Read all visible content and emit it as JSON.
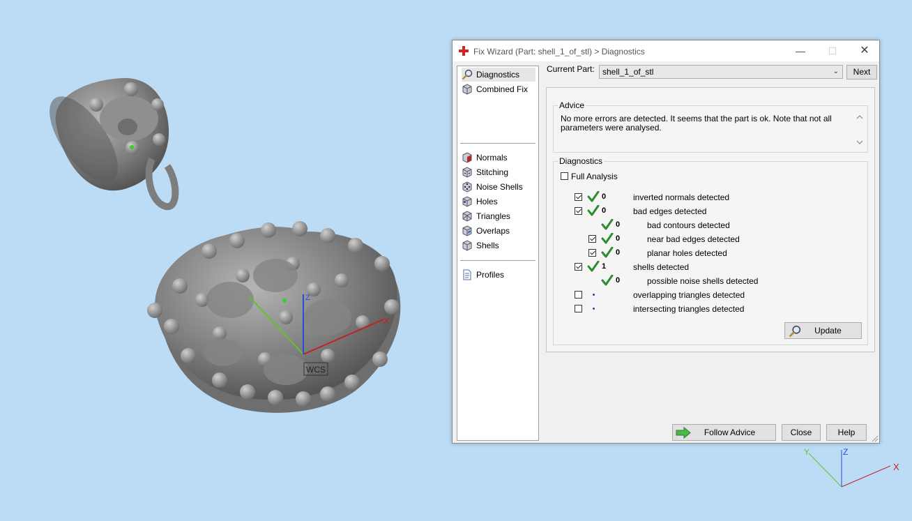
{
  "window": {
    "title": "Fix Wizard (Part: shell_1_of_stl) > Diagnostics",
    "minimize_glyph": "—",
    "maximize_glyph": "☐",
    "close_glyph": "✕"
  },
  "nav": {
    "items": [
      {
        "label": "Diagnostics",
        "icon": "magnifier-icon",
        "active": true
      },
      {
        "label": "Combined Fix",
        "icon": "cube-icon"
      },
      {
        "label": "Normals",
        "icon": "normals-cube-icon"
      },
      {
        "label": "Stitching",
        "icon": "stitching-cube-icon"
      },
      {
        "label": "Noise Shells",
        "icon": "dice-icon"
      },
      {
        "label": "Holes",
        "icon": "holes-cube-icon"
      },
      {
        "label": "Triangles",
        "icon": "triangles-cube-icon"
      },
      {
        "label": "Overlaps",
        "icon": "overlaps-cube-icon"
      },
      {
        "label": "Shells",
        "icon": "shells-cube-icon"
      },
      {
        "label": "Profiles",
        "icon": "document-icon"
      }
    ]
  },
  "header": {
    "current_part_label": "Current Part:",
    "current_part_value": "shell_1_of_stl",
    "next_label": "Next"
  },
  "advice": {
    "title": "Advice",
    "text": "No more errors are detected. It seems that the part is ok. Note that not all parameters were analysed."
  },
  "diagnostics": {
    "title": "Diagnostics",
    "full_analysis_label": "Full Analysis",
    "full_analysis_checked": false,
    "rows": [
      {
        "checkbox": true,
        "checked": true,
        "status": "ok",
        "count": "0",
        "label": "inverted normals detected",
        "indent": 0
      },
      {
        "checkbox": true,
        "checked": true,
        "status": "ok",
        "count": "0",
        "label": "bad edges detected",
        "indent": 0
      },
      {
        "checkbox": false,
        "checked": false,
        "status": "ok",
        "count": "0",
        "label": "bad contours detected",
        "indent": 1
      },
      {
        "checkbox": true,
        "checked": true,
        "status": "ok",
        "count": "0",
        "label": "near bad edges detected",
        "indent": 1
      },
      {
        "checkbox": true,
        "checked": true,
        "status": "ok",
        "count": "0",
        "label": "planar holes detected",
        "indent": 1
      },
      {
        "checkbox": true,
        "checked": true,
        "status": "ok",
        "count": "1",
        "label": "shells detected",
        "indent": 0
      },
      {
        "checkbox": false,
        "checked": false,
        "status": "ok",
        "count": "0",
        "label": "possible noise shells detected",
        "indent": 1
      },
      {
        "checkbox": true,
        "checked": false,
        "status": "none",
        "count": "",
        "label": "overlapping triangles detected",
        "indent": 0
      },
      {
        "checkbox": true,
        "checked": false,
        "status": "none",
        "count": "",
        "label": "intersecting triangles detected",
        "indent": 0
      }
    ],
    "update_label": "Update"
  },
  "footer": {
    "follow_advice_label": "Follow Advice",
    "close_label": "Close",
    "help_label": "Help"
  },
  "viewport": {
    "wcs_label": "WCS",
    "axis_x": "X",
    "axis_y": "Y",
    "axis_z": "Z",
    "background_color": "#bcdcf6",
    "ok_color": "#2e8b2e"
  }
}
